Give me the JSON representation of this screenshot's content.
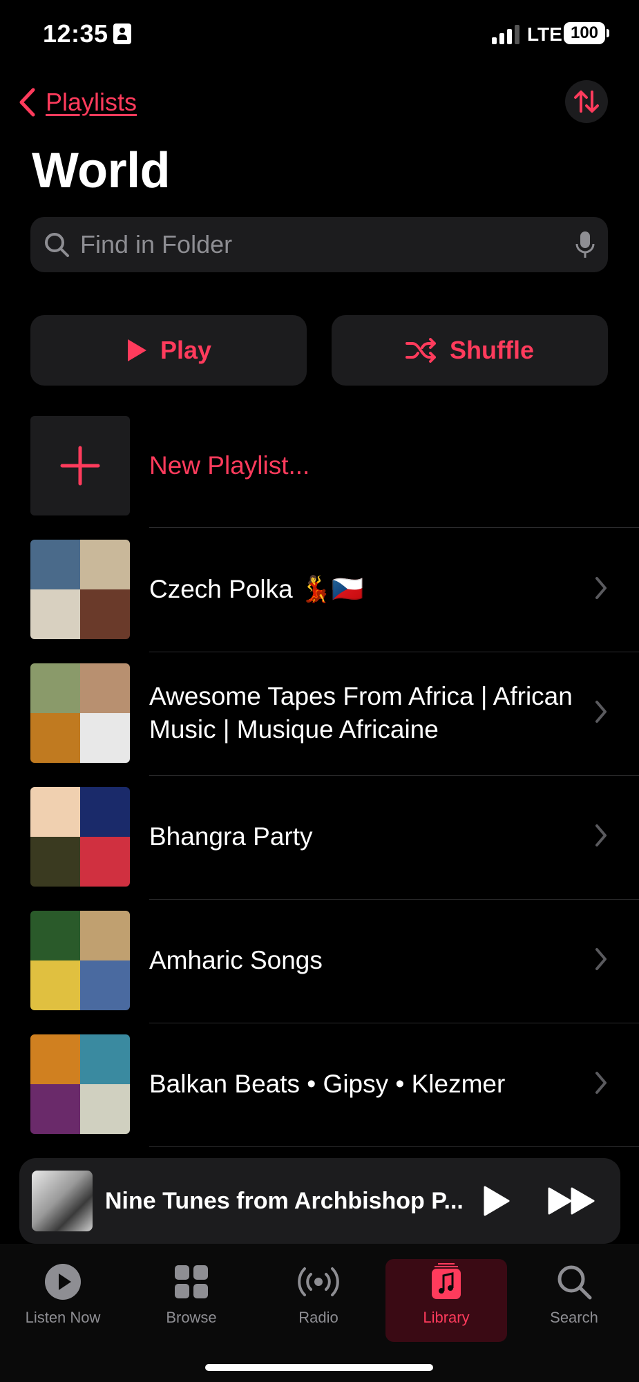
{
  "status": {
    "time": "12:35",
    "network": "LTE",
    "battery": "100"
  },
  "nav": {
    "back_label": "Playlists"
  },
  "page": {
    "title": "World"
  },
  "search": {
    "placeholder": "Find in Folder"
  },
  "actions": {
    "play_label": "Play",
    "shuffle_label": "Shuffle"
  },
  "new_playlist": {
    "label": "New Playlist..."
  },
  "playlists": [
    {
      "title": "Czech Polka 💃🇨🇿",
      "colors": [
        "#4a6a8a",
        "#c9b89a",
        "#d8d0c0",
        "#6a3a2a"
      ]
    },
    {
      "title": "Awesome Tapes From Africa | African Music | Musique Africaine",
      "colors": [
        "#8a9a6a",
        "#b89070",
        "#c07a20",
        "#e8e8e8"
      ]
    },
    {
      "title": "Bhangra Party",
      "colors": [
        "#f0d0b0",
        "#1a2a6a",
        "#3a3a20",
        "#d03040"
      ]
    },
    {
      "title": "Amharic Songs",
      "colors": [
        "#2a5a2a",
        "#c0a070",
        "#e0c040",
        "#4a6aa0"
      ]
    },
    {
      "title": "Balkan Beats • Gipsy • Klezmer",
      "colors": [
        "#d08020",
        "#3a8aa0",
        "#6a2a6a",
        "#d0d0c0"
      ]
    }
  ],
  "mini_player": {
    "title": "Nine Tunes from Archbishop P..."
  },
  "tabs": [
    {
      "label": "Listen Now"
    },
    {
      "label": "Browse"
    },
    {
      "label": "Radio"
    },
    {
      "label": "Library"
    },
    {
      "label": "Search"
    }
  ]
}
